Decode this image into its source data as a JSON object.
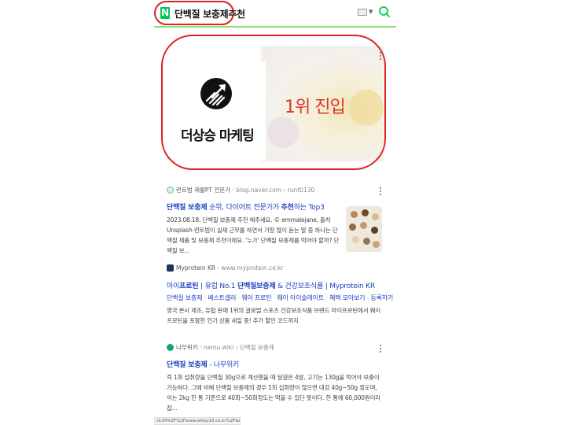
{
  "search": {
    "logo_letter": "N",
    "query": "단백질 보충제추천"
  },
  "ad": {
    "brand_name": "더상승 마케팅",
    "overlay_text": "1위 진입"
  },
  "results": [
    {
      "source_name": "런트범 재활PT 전문가",
      "source_host": "blog.naver.com › runt0130",
      "title_parts": [
        "단백질 보충제",
        " 순위, 다이어트 전문가가 ",
        "추천",
        "하는 Top3"
      ],
      "description": "2023.08.18. 단백질 보충제 추천 해주세요. © emmalejane, 출처 Unsplash 런트범이 실제 근무를 하면서 가장 많이 듣는 말 중 하나는 단백질 제품 및 보충제 추천이에요. '누가' 단백질 보충제를 먹어야 할까? 단백질 보..."
    },
    {
      "source_name": "Myprotein KR",
      "source_host": "www.myprotein.co.kr",
      "title_parts": [
        "마이",
        "프로틴",
        " | 유럽 No.1 ",
        "단백질보충제",
        " & 건강보조식품 | Myprotein KR"
      ],
      "sublinks": [
        "단백질 보충제",
        "베스트셀러",
        "웨이 프로틴",
        "웨이 아이솔레이트",
        "혜택 모아보기",
        "등록하기"
      ],
      "description": "영국 본사 제조, 유럽 판매 1위의 글로벌 스포츠 건강보조식품 브랜드 마이프로틴에서 웨이프로틴을 포함한 인기 상품 세일 중! 추가 할인 코드까지"
    },
    {
      "source_name": "나무위키",
      "source_host": "namu.wiki › 단백질 보충제",
      "title_parts": [
        "단백질 보충제",
        " - 나무위키"
      ],
      "description": "즉 1회 섭취량을 단백질 30g으로 계산했을 때 달걀은 4알, 고기는 130g을 먹어야 보충이 가능하다. 그에 비해 단백질 보충제의 경우 1회 섭취량이 많으면 대강 40g~50g 정도며, 이는 2kg 한 통 기준으로 40회~50회정도는 먹을 수 있단 뜻이다. 한 통에 60,000원이라 잡..."
    }
  ],
  "status_bar": {
    "url": "ck34%2F%2Fwww.whey10.co.kr%2F&rb=d..."
  },
  "colors": {
    "naver_green": "#03c75a",
    "link_blue": "#1a3ebf",
    "highlight_red": "#dd2222"
  },
  "icons": [
    "naver-logo-icon",
    "keyboard-icon",
    "search-icon",
    "more-icon",
    "brand-arrow-icon"
  ]
}
